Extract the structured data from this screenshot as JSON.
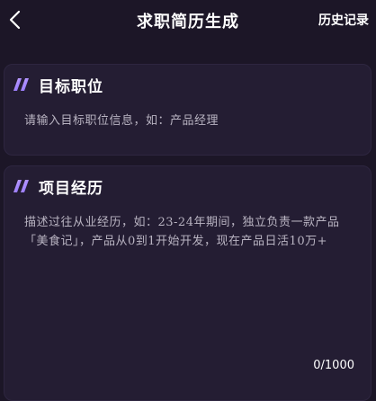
{
  "header": {
    "title": "求职简历生成",
    "history_label": "历史记录",
    "back_icon": "chevron-left-icon"
  },
  "target_section": {
    "title": "目标职位",
    "icon": "double-slash-icon",
    "placeholder": "请输入目标职位信息，如：产品经理"
  },
  "project_section": {
    "title": "项目经历",
    "icon": "double-slash-icon",
    "placeholder": "描述过往从业经历，如：23-24年期间，独立负责一款产品「美食记」，产品从0到1开始开发，现在产品日活10万+",
    "counter": "0/1000"
  },
  "colors": {
    "background": "#1c1627",
    "card": "#241d33",
    "accent_start": "#c9a6ff",
    "accent_end": "#7a5cff",
    "placeholder_text": "#b9b4c2"
  }
}
